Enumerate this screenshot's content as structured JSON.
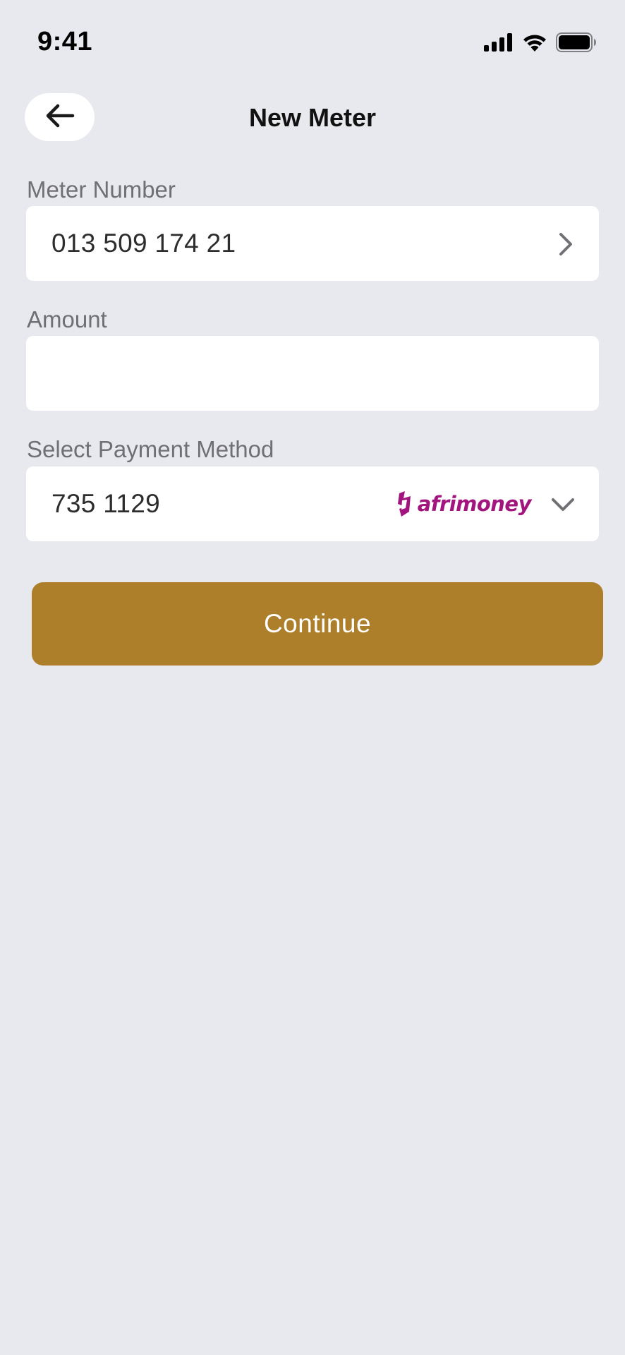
{
  "status_bar": {
    "time": "9:41",
    "icons": [
      "signal-icon",
      "wifi-icon",
      "battery-icon"
    ]
  },
  "header": {
    "title": "New Meter",
    "back_icon": "arrow-left-icon"
  },
  "meter_number": {
    "label": "Meter Number",
    "value": "013 509 174 21",
    "icon": "chevron-right-icon"
  },
  "amount": {
    "label": "Amount",
    "value": "",
    "placeholder": ""
  },
  "payment_method": {
    "label": "Select Payment Method",
    "value": "735 1129",
    "provider_logo_text": "afrimoney",
    "icon": "chevron-down-icon"
  },
  "continue_button": {
    "label": "Continue"
  },
  "colors": {
    "background": "#e8e9ee",
    "field": "#ffffff",
    "primary": "#ad7f2a",
    "label": "#6f6f74",
    "brand_afrimoney": "#a3157e"
  }
}
